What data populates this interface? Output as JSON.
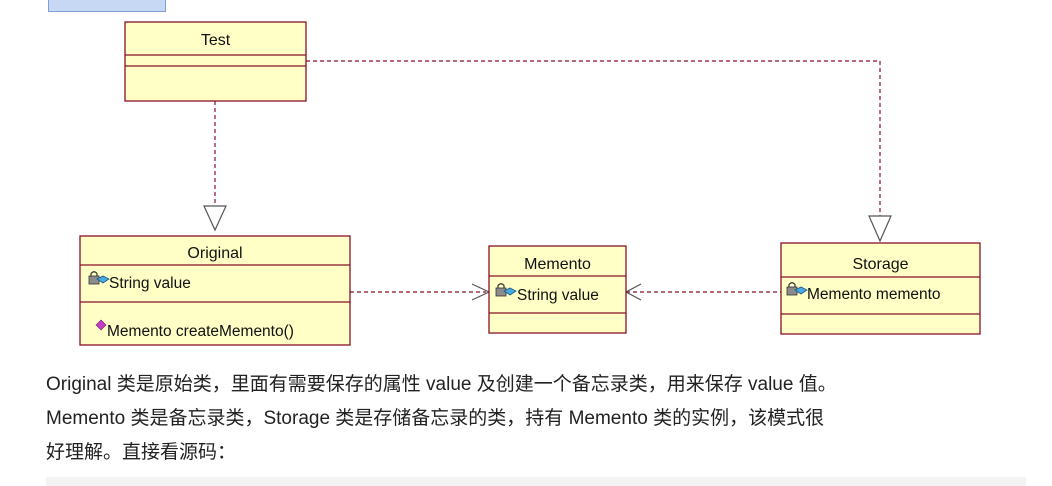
{
  "diagram": {
    "classes": [
      {
        "id": "test",
        "name": "Test",
        "attributes": [],
        "operations": []
      },
      {
        "id": "original",
        "name": "Original",
        "attributes": [
          "String value"
        ],
        "operations": [
          "Memento createMemento()"
        ]
      },
      {
        "id": "memento",
        "name": "Memento",
        "attributes": [
          "String value"
        ],
        "operations": []
      },
      {
        "id": "storage",
        "name": "Storage",
        "attributes": [
          "Memento memento"
        ],
        "operations": []
      }
    ],
    "relations": [
      {
        "from": "Test",
        "to": "Original",
        "kind": "dependency"
      },
      {
        "from": "Test",
        "to": "Storage",
        "kind": "dependency"
      },
      {
        "from": "Original",
        "to": "Memento",
        "kind": "dependency"
      },
      {
        "from": "Storage",
        "to": "Memento",
        "kind": "dependency"
      }
    ],
    "colors": {
      "box_fill": "#ffffc6",
      "box_border": "#8a0f28",
      "line": "#8a0f28",
      "text": "#111111"
    },
    "icons": {
      "attribute": "lock-field-icon",
      "operation": "purple-diamond-method-icon"
    }
  },
  "description": {
    "lines": [
      "Original 类是原始类，里面有需要保存的属性 value 及创建一个备忘录类，用来保存 value 值。",
      "Memento 类是备忘录类，Storage 类是存储备忘录的类，持有 Memento 类的实例，该模式很",
      "好理解。直接看源码："
    ]
  }
}
